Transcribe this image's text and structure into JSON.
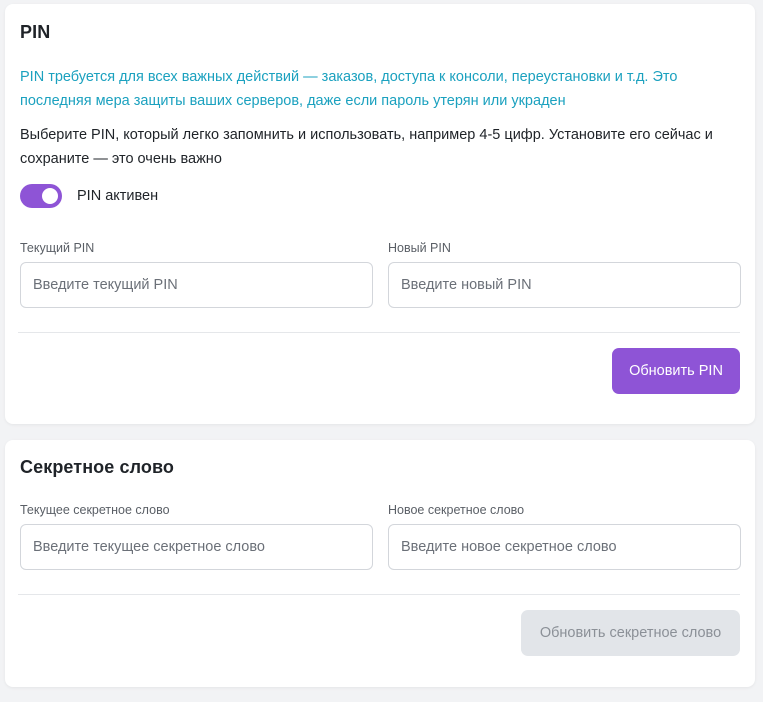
{
  "pin_section": {
    "title": "PIN",
    "info_text": "PIN требуется для всех важных действий — заказов, доступа к консоли, переустановки и т.д. Это последняя мера защиты ваших серверов, даже если пароль утерян или украден",
    "description": "Выберите PIN, который легко запомнить и использовать, например 4-5 цифр. Установите его сейчас и сохраните — это очень важно",
    "toggle": {
      "label": "PIN активен",
      "enabled": true
    },
    "current_pin": {
      "label": "Текущий PIN",
      "placeholder": "Введите текущий PIN",
      "value": ""
    },
    "new_pin": {
      "label": "Новый PIN",
      "placeholder": "Введите новый PIN",
      "value": ""
    },
    "submit_label": "Обновить PIN"
  },
  "secret_section": {
    "title": "Секретное слово",
    "current_secret": {
      "label": "Текущее секретное слово",
      "placeholder": "Введите текущее секретное слово",
      "value": ""
    },
    "new_secret": {
      "label": "Новое секретное слово",
      "placeholder": "Введите новое секретное слово",
      "value": ""
    },
    "submit_label": "Обновить секретное слово",
    "submit_disabled": true
  },
  "colors": {
    "accent": "#8e54d6",
    "info_text": "#1ba1bf",
    "disabled_button_bg": "#e2e5e9",
    "page_bg": "#f2f3f5"
  }
}
